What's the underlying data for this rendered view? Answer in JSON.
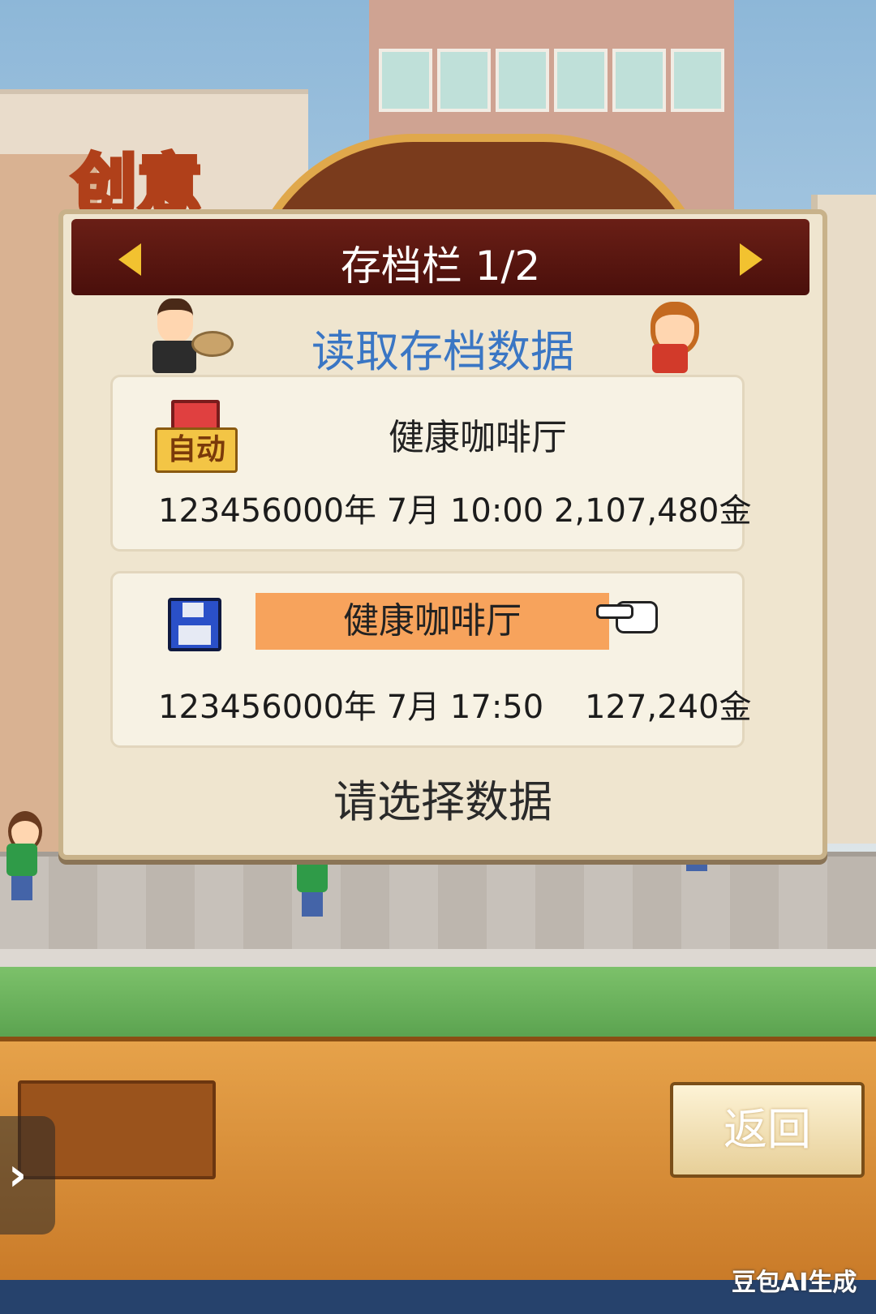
{
  "scene": {
    "sign_text": "创意"
  },
  "dialog": {
    "header_title": "存档栏 1/2",
    "subtitle": "读取存档数据",
    "prompt": "请选择数据",
    "slots": [
      {
        "badge": "自动",
        "name": "健康咖啡厅",
        "info": "123456000年 7月 10:00 2,107,480金",
        "icon": "auto-save-icon"
      },
      {
        "name": "健康咖啡厅",
        "info": "123456000年 7月 17:50    127,240金",
        "icon": "floppy-disk-icon",
        "selected": true
      }
    ]
  },
  "bottom": {
    "back_label": "返回",
    "side_tab_glyph": "›"
  },
  "watermark": "豆包AI生成",
  "colors": {
    "header_bg": "#5a1712",
    "subtitle": "#3a76c4",
    "selected_slot": "#f7a35c",
    "bottom_bar": "#d88a34"
  }
}
